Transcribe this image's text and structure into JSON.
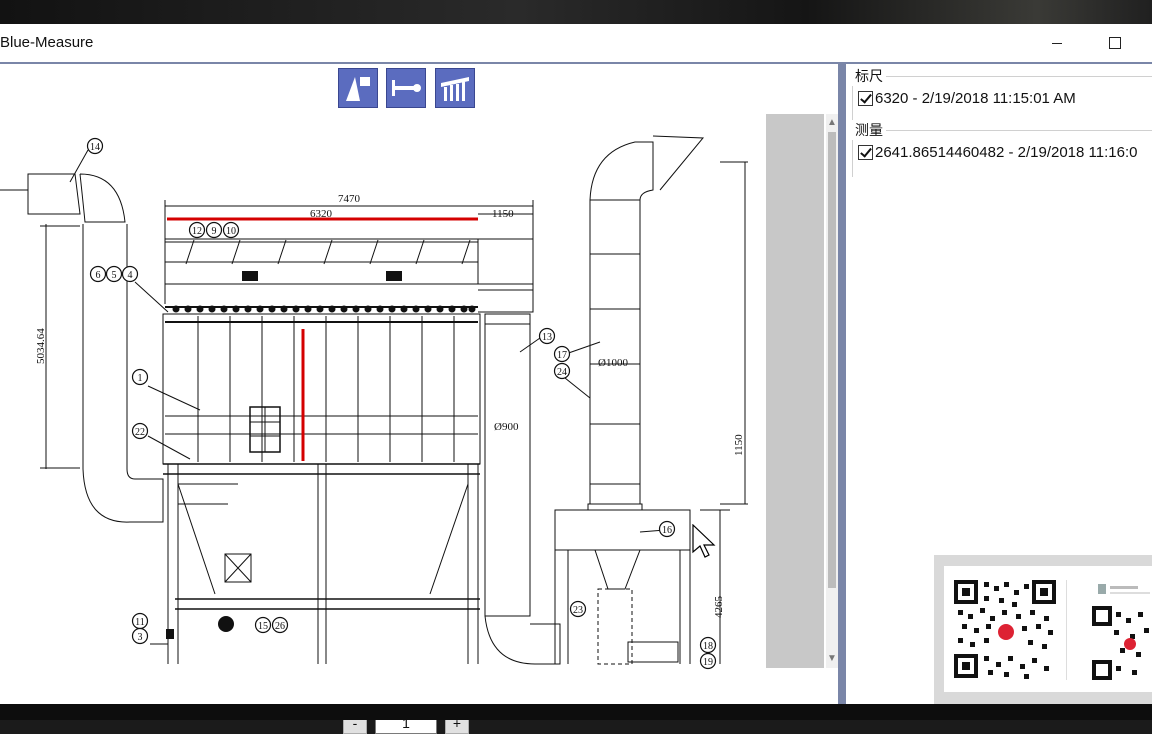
{
  "app": {
    "title": "Blue-Measure"
  },
  "window_controls": {
    "minimize_icon": "minimize-icon",
    "maximize_icon": "maximize-icon"
  },
  "toolbar": {
    "buttons": [
      {
        "icon": "scale-reference-icon"
      },
      {
        "icon": "measure-line-icon"
      },
      {
        "icon": "ruler-icon"
      }
    ]
  },
  "drawing": {
    "dimensions": [
      "7470",
      "6320",
      "1150",
      "5034.64",
      "Ø900",
      "Ø1000",
      "1150",
      "4265"
    ],
    "callouts": [
      "14",
      "12",
      "9",
      "10",
      "6",
      "5",
      "4",
      "1",
      "22",
      "13",
      "17",
      "24",
      "16",
      "23",
      "11",
      "3",
      "15",
      "26",
      "18",
      "19"
    ]
  },
  "pager": {
    "minus_label": "-",
    "page_value": "1",
    "plus_label": "+"
  },
  "panel": {
    "scale_group": {
      "label": "标尺",
      "items": [
        {
          "text": "6320 - 2/19/2018 11:15:01 AM",
          "checked": true
        }
      ]
    },
    "measure_group": {
      "label": "测量",
      "items": [
        {
          "text": "2641.86514460482 - 2/19/2018 11:16:0",
          "checked": true
        }
      ]
    }
  },
  "colors": {
    "accent": "#5b6cbf",
    "frame": "#7a86a8",
    "measure_line": "#d40000"
  }
}
